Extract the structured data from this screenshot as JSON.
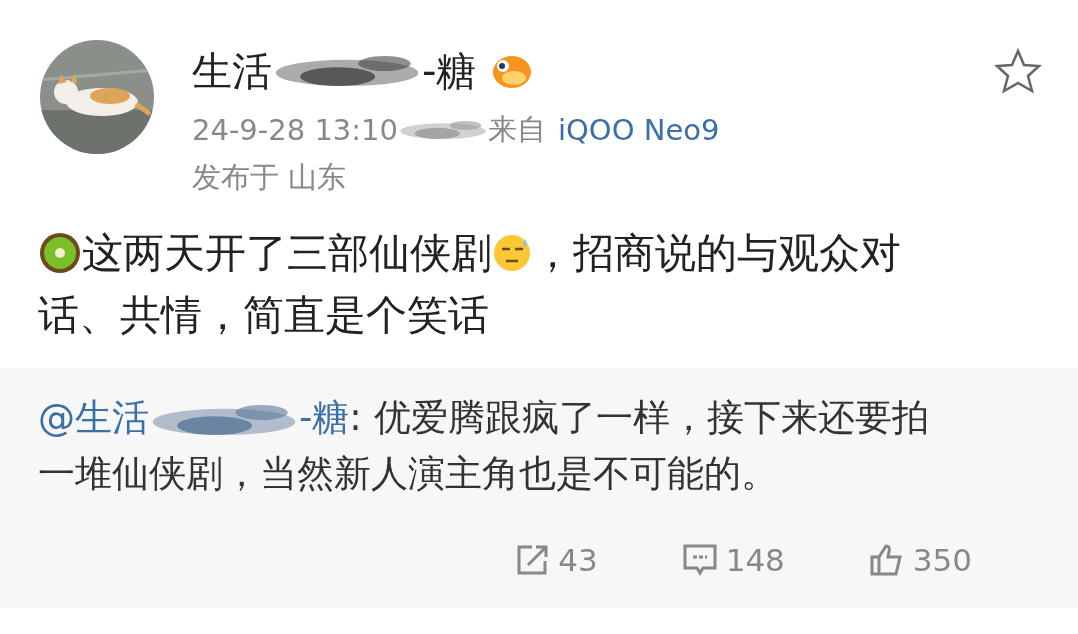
{
  "post": {
    "author": {
      "name_start": "生活",
      "name_end": "-糖"
    },
    "time": "24-9-28 13:10",
    "source_prefix": "来自",
    "source": "iQOO Neo9",
    "location": "发布于 山东",
    "text_before": "这两天开了三部仙侠剧",
    "text_after": "，招商说的与观众对",
    "text_line2": "话、共情，简直是个笑话"
  },
  "quote": {
    "mention_start": "@生活",
    "mention_end": "-糖",
    "text": ": 优爱腾跟疯了一样，接下来还要拍",
    "text_line2": "一堆仙侠剧，当然新人演主角也是不可能的。"
  },
  "actions": [
    {
      "kind": "repost",
      "count": "43"
    },
    {
      "kind": "comment",
      "count": "148"
    },
    {
      "kind": "like",
      "count": "350"
    }
  ]
}
